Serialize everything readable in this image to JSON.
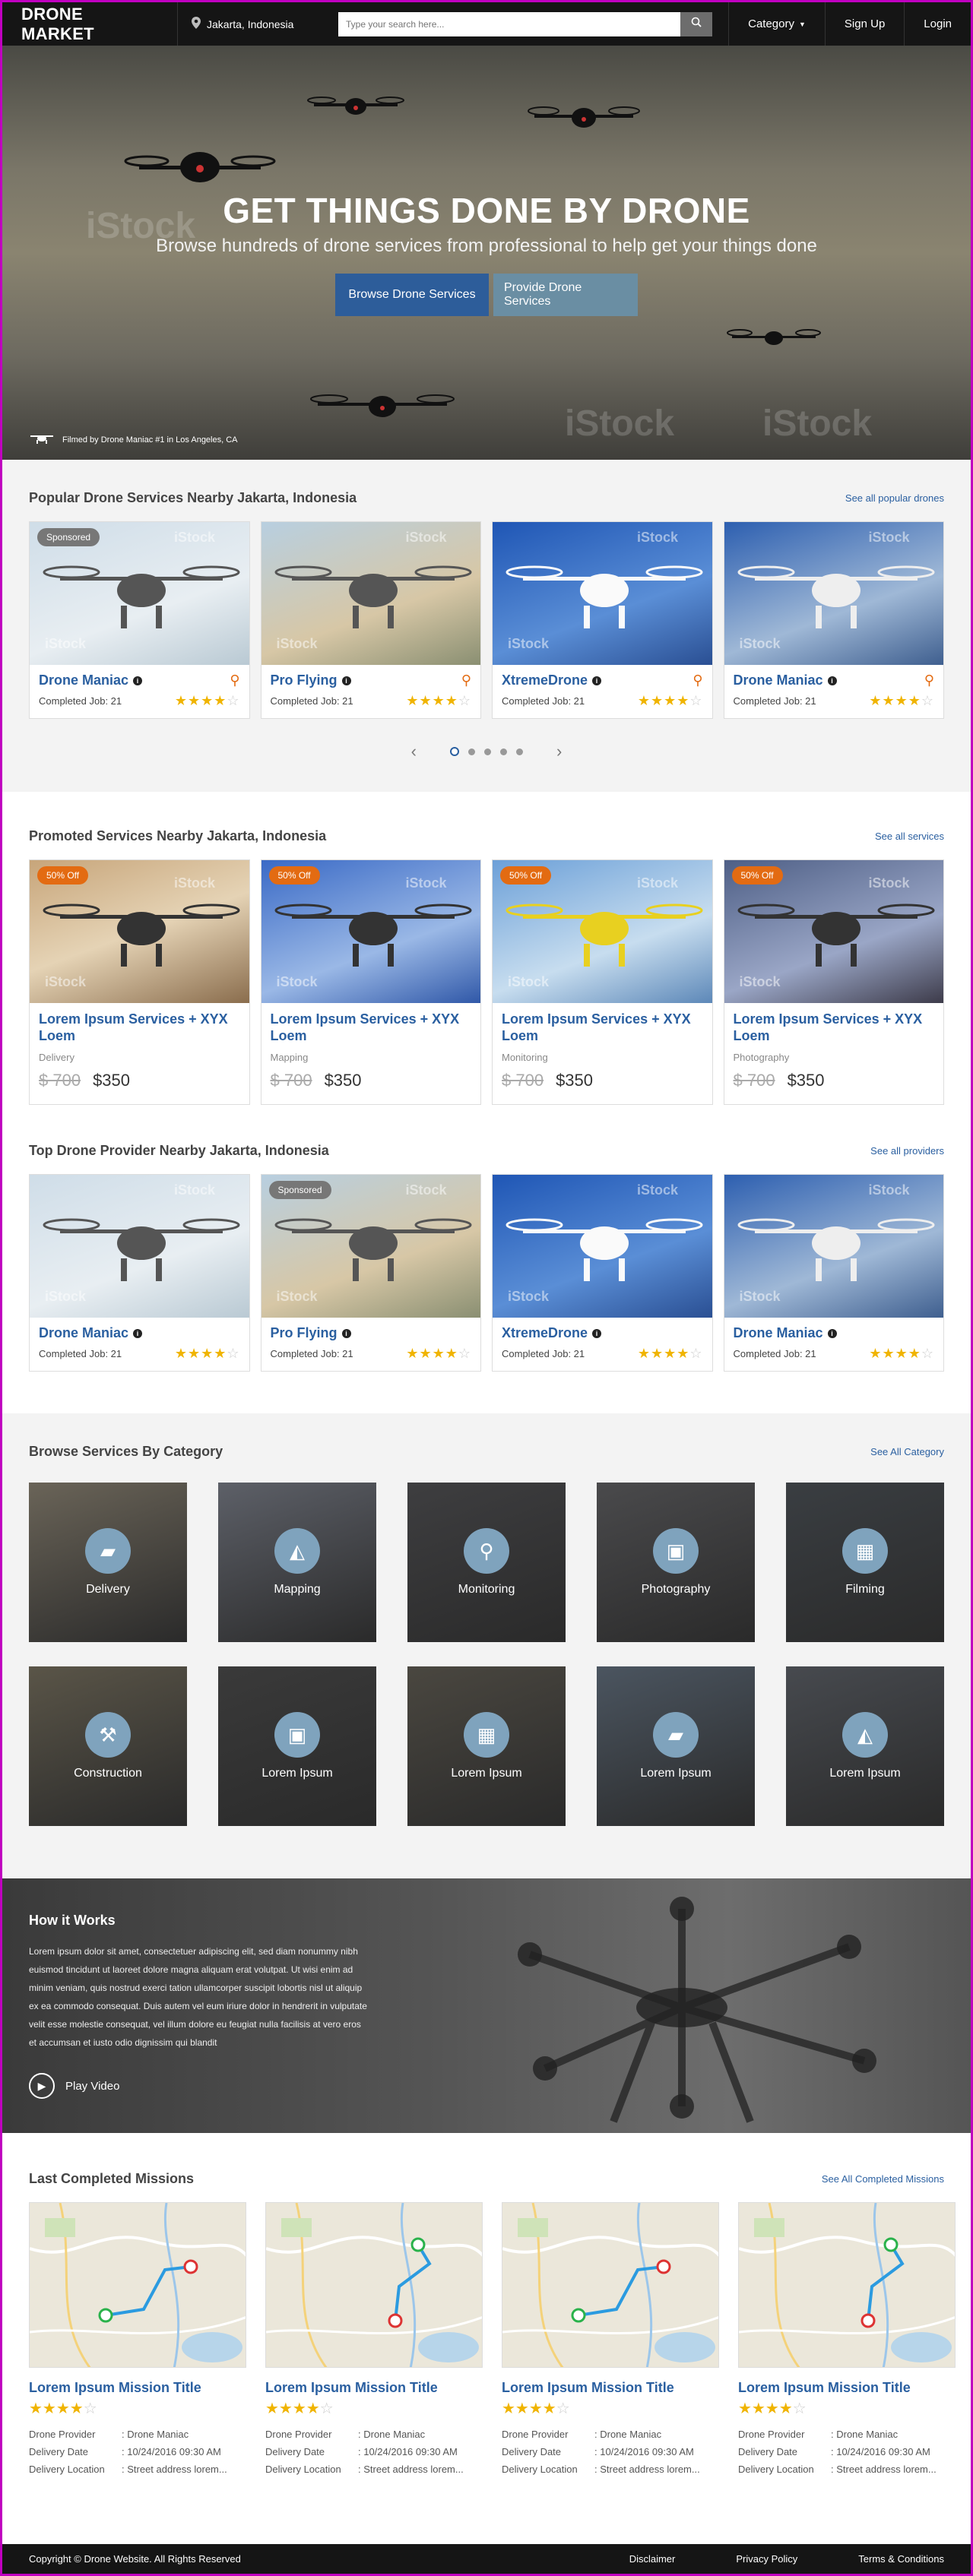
{
  "nav": {
    "brand": "DRONE MARKET",
    "location": "Jakarta, Indonesia",
    "search_placeholder": "Type your search here...",
    "category": "Category",
    "signup": "Sign Up",
    "login": "Login"
  },
  "hero": {
    "title": "GET THINGS DONE BY DRONE",
    "subtitle": "Browse hundreds of drone services from professional to help get your things done",
    "btn_browse": "Browse Drone Services",
    "btn_provide": "Provide Drone Services",
    "credit": "Filmed by Drone Maniac #1 in Los Angeles, CA"
  },
  "popular": {
    "title": "Popular Drone Services Nearby Jakarta, Indonesia",
    "link": "See all popular drones",
    "sponsored": "Sponsored",
    "items": [
      {
        "name": "Drone Maniac",
        "job": "Completed Job: 21",
        "rating": 4
      },
      {
        "name": "Pro Flying",
        "job": "Completed Job: 21",
        "rating": 4
      },
      {
        "name": "XtremeDrone",
        "job": "Completed Job: 21",
        "rating": 4
      },
      {
        "name": "Drone Maniac",
        "job": "Completed Job: 21",
        "rating": 4
      }
    ],
    "pager_prev": "‹",
    "pager_next": "›"
  },
  "promoted": {
    "title": "Promoted Services Nearby Jakarta, Indonesia",
    "link": "See all services",
    "items": [
      {
        "badge": "50% Off",
        "title": "Lorem Ipsum Services + XYX Loem",
        "category": "Delivery",
        "old": "$ 700",
        "price": "$350"
      },
      {
        "badge": "50% Off",
        "title": "Lorem Ipsum Services + XYX Loem",
        "category": "Mapping",
        "old": "$ 700",
        "price": "$350"
      },
      {
        "badge": "50% Off",
        "title": "Lorem Ipsum Services + XYX Loem",
        "category": "Monitoring",
        "old": "$ 700",
        "price": "$350"
      },
      {
        "badge": "50% Off",
        "title": "Lorem Ipsum Services + XYX Loem",
        "category": "Photography",
        "old": "$ 700",
        "price": "$350"
      }
    ]
  },
  "top": {
    "title": "Top Drone Provider Nearby Jakarta, Indonesia",
    "link": "See all providers",
    "sponsored": "Sponsored",
    "items": [
      {
        "name": "Drone Maniac",
        "job": "Completed Job: 21",
        "rating": 4
      },
      {
        "name": "Pro Flying",
        "job": "Completed Job: 21",
        "rating": 4
      },
      {
        "name": "XtremeDrone",
        "job": "Completed Job: 21",
        "rating": 4
      },
      {
        "name": "Drone Maniac",
        "job": "Completed Job: 21",
        "rating": 4
      }
    ]
  },
  "categories": {
    "title": "Browse Services By Category",
    "link": "See All Category",
    "items": [
      {
        "label": "Delivery",
        "icon": "box-icon"
      },
      {
        "label": "Mapping",
        "icon": "map-icon"
      },
      {
        "label": "Monitoring",
        "icon": "magnifier-icon"
      },
      {
        "label": "Photography",
        "icon": "photo-icon"
      },
      {
        "label": "Filming",
        "icon": "film-icon"
      },
      {
        "label": "Construction",
        "icon": "hammer-icon"
      },
      {
        "label": "Lorem Ipsum",
        "icon": "photo-icon"
      },
      {
        "label": "Lorem Ipsum",
        "icon": "film-icon"
      },
      {
        "label": "Lorem Ipsum",
        "icon": "box-icon"
      },
      {
        "label": "Lorem Ipsum",
        "icon": "map-icon"
      }
    ]
  },
  "how": {
    "title": "How it Works",
    "text": "Lorem ipsum dolor sit amet, consectetuer adipiscing elit, sed diam nonummy nibh euismod tincidunt ut laoreet dolore magna aliquam erat volutpat. Ut wisi enim ad minim veniam, quis nostrud exerci tation ullamcorper suscipit lobortis nisl ut aliquip ex ea commodo consequat. Duis autem vel eum iriure dolor in hendrerit in vulputate velit esse molestie consequat, vel illum dolore eu feugiat nulla facilisis at vero eros et accumsan et iusto odio dignissim qui blandit",
    "play": "Play Video"
  },
  "missions": {
    "title": "Last Completed Missions",
    "link": "See All Completed Missions",
    "k_provider": "Drone Provider",
    "k_date": "Delivery Date",
    "k_loc": "Delivery Location",
    "items": [
      {
        "title": "Lorem Ipsum Mission Title",
        "provider": ": Drone Maniac",
        "date": ": 10/24/2016  09:30 AM",
        "loc": ": Street address lorem...",
        "rating": 4
      },
      {
        "title": "Lorem Ipsum Mission Title",
        "provider": ": Drone Maniac",
        "date": ": 10/24/2016  09:30 AM",
        "loc": ": Street address lorem...",
        "rating": 4
      },
      {
        "title": "Lorem Ipsum Mission Title",
        "provider": ": Drone Maniac",
        "date": ": 10/24/2016  09:30 AM",
        "loc": ": Street address lorem...",
        "rating": 4
      },
      {
        "title": "Lorem Ipsum Mission Title",
        "provider": ": Drone Maniac",
        "date": ": 10/24/2016  09:30 AM",
        "loc": ": Street address lorem...",
        "rating": 4
      }
    ]
  },
  "footer": {
    "copy": "Copyright © Drone Website. All Rights Reserved",
    "disclaimer": "Disclaimer",
    "privacy": "Privacy Policy",
    "terms": "Terms & Conditions"
  },
  "colors": {
    "accent": "#2a5fa0",
    "badge_off": "#e36b12",
    "nav_bg": "#151515"
  }
}
